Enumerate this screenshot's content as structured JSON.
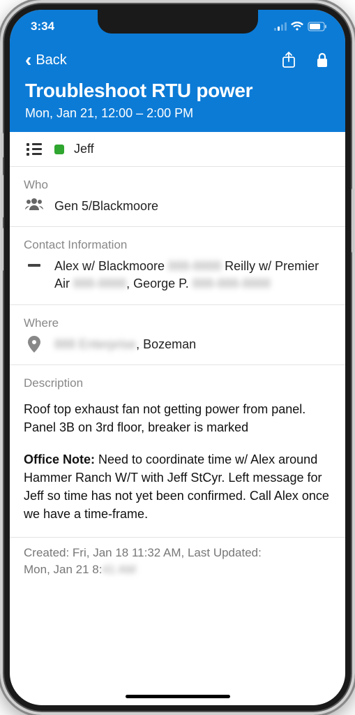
{
  "status": {
    "time": "3:34"
  },
  "header": {
    "back_label": "Back",
    "title": "Troubleshoot RTU power",
    "datetime": "Mon, Jan 21, 12:00 – 2:00 PM"
  },
  "assignee": {
    "name": "Jeff",
    "color": "#2fa62f"
  },
  "sections": {
    "who": {
      "label": "Who",
      "value": "Gen 5/Blackmoore"
    },
    "contact": {
      "label": "Contact Information",
      "prefix": "Alex w/ Blackmoore ",
      "redacted1": "888-8888",
      "mid1": " Reilly w/ Premier Air ",
      "redacted2": "888-8888",
      "mid2": ", George P. ",
      "redacted3": "888-888-8888"
    },
    "where": {
      "label": "Where",
      "redacted": "888 Enterprise",
      "suffix": ", Bozeman"
    },
    "description": {
      "label": "Description",
      "para1": "Roof top exhaust fan not getting power from panel. Panel 3B on 3rd floor, breaker is marked",
      "note_label": "Office Note:",
      "note_body": " Need to coordinate time w/ Alex around Hammer Ranch W/T with Jeff StCyr. Left message for Jeff so time has not yet been confirmed. Call Alex once we have a time-frame."
    }
  },
  "meta": {
    "line1": "Created: Fri, Jan 18 11:32 AM, Last Updated:",
    "line2_prefix": "Mon, Jan 21 8:",
    "line2_redacted": "41 AM"
  }
}
